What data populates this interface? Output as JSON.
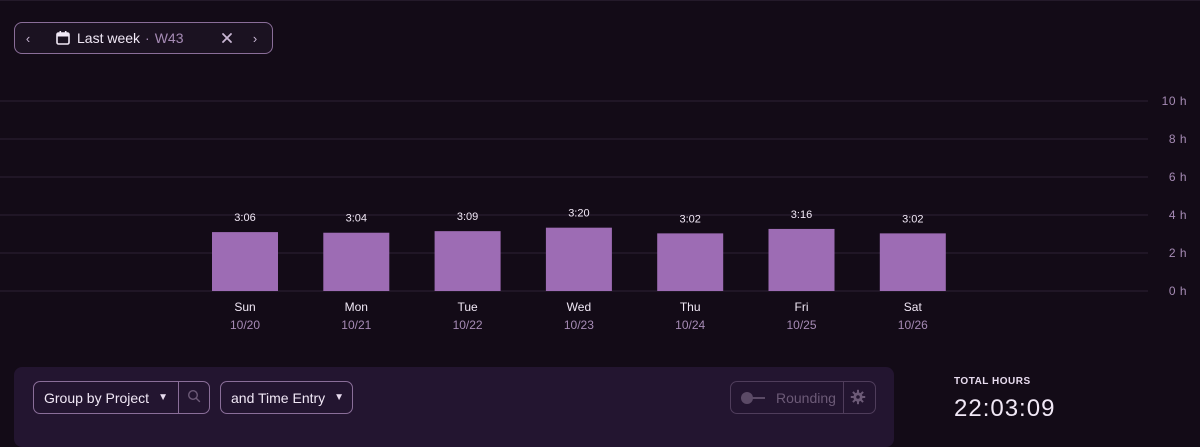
{
  "period": {
    "label": "Last week",
    "separator": "·",
    "week": "W43",
    "prev_icon": "chevron-left-icon",
    "next_icon": "chevron-right-icon",
    "calendar_icon": "calendar-icon",
    "clear_icon": "close-icon"
  },
  "chart_data": {
    "type": "bar",
    "categories": [
      "Sun",
      "Mon",
      "Tue",
      "Wed",
      "Thu",
      "Fri",
      "Sat"
    ],
    "dates": [
      "10/20",
      "10/21",
      "10/22",
      "10/23",
      "10/24",
      "10/25",
      "10/26"
    ],
    "series": [
      {
        "values": [
          3.1,
          3.067,
          3.15,
          3.333,
          3.033,
          3.267,
          3.033
        ],
        "value_labels": [
          "3:06",
          "3:04",
          "3:09",
          "3:20",
          "3:02",
          "3:16",
          "3:02"
        ]
      }
    ],
    "unit": "h",
    "ylim": [
      0,
      10
    ],
    "yticks": [
      "0 h",
      "2 h",
      "4 h",
      "6 h",
      "8 h",
      "10 h"
    ],
    "ytick_values": [
      0,
      2,
      4,
      6,
      8,
      10
    ],
    "grid": true,
    "bar_color": "#9d6cb4"
  },
  "controls": {
    "group_by": "Group by Project",
    "sub_group": "and Time Entry",
    "rounding": "Rounding",
    "search_icon": "search-icon",
    "settings_icon": "gear-icon"
  },
  "totals": {
    "label": "TOTAL HOURS",
    "value": "22:03:09"
  },
  "colors": {
    "background": "#130b17",
    "panel": "#231530",
    "accent": "#9d6cb4",
    "muted": "#a68bb5"
  }
}
